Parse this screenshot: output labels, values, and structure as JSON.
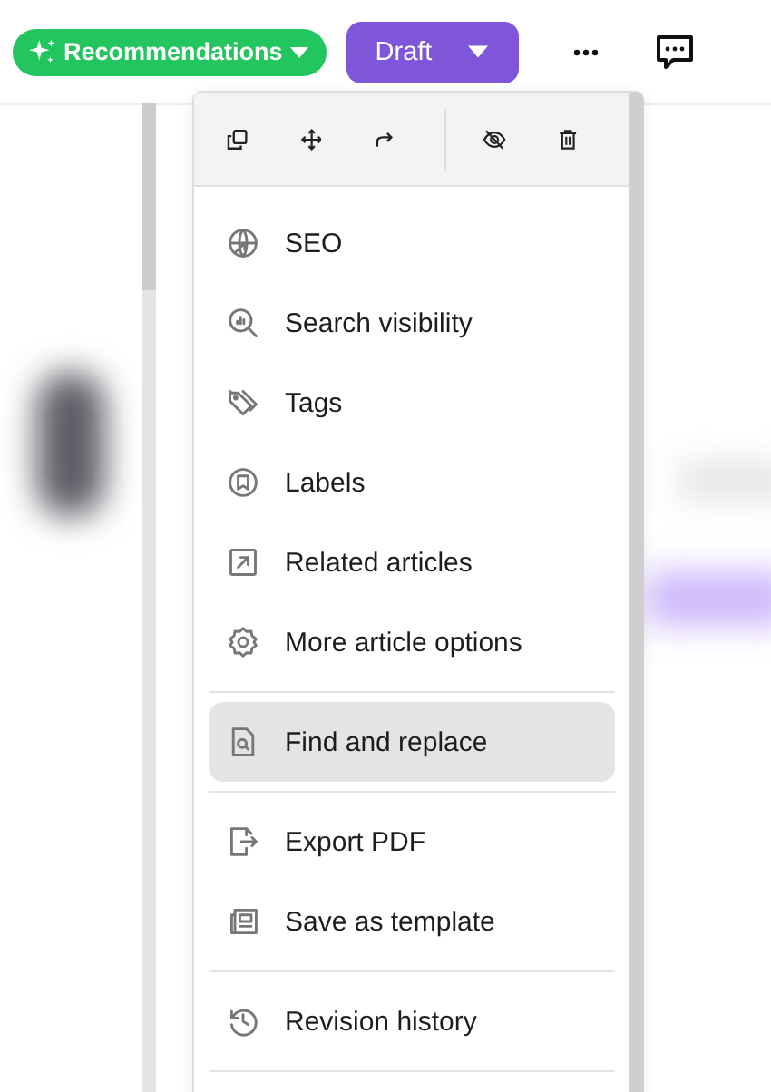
{
  "header": {
    "recommendations": "Recommendations",
    "status": "Draft"
  },
  "menu": {
    "groups": [
      {
        "items": [
          {
            "label": "SEO",
            "selected": false
          },
          {
            "label": "Search visibility",
            "selected": false
          },
          {
            "label": "Tags",
            "selected": false
          },
          {
            "label": "Labels",
            "selected": false
          },
          {
            "label": "Related articles",
            "selected": false
          },
          {
            "label": "More article options",
            "selected": false
          }
        ]
      },
      {
        "items": [
          {
            "label": "Find and replace",
            "selected": true
          }
        ]
      },
      {
        "items": [
          {
            "label": "Export PDF",
            "selected": false
          },
          {
            "label": "Save as template",
            "selected": false
          }
        ]
      },
      {
        "items": [
          {
            "label": "Revision history",
            "selected": false
          }
        ]
      }
    ]
  }
}
